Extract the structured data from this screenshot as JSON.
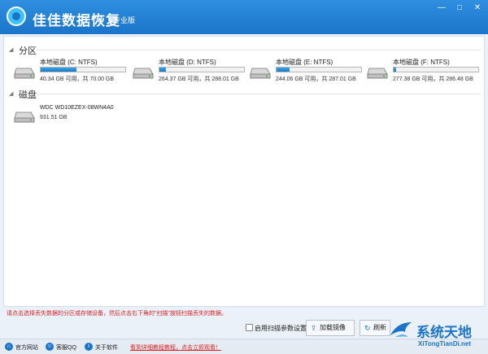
{
  "window": {
    "title": "佳佳数据恢复",
    "edition": "专业版",
    "minimize": "—",
    "maximize": "□",
    "close": "✕"
  },
  "sections": {
    "partitions": "分区",
    "disks": "磁盘"
  },
  "partitions": [
    {
      "name": "本地磁盘 (C: NTFS)",
      "info": "40.34 GB 可用，共 70.00 GB",
      "used_fraction": 0.42
    },
    {
      "name": "本地磁盘 (D: NTFS)",
      "info": "264.37 GB 可用，共 288.01 GB",
      "used_fraction": 0.08
    },
    {
      "name": "本地磁盘 (E: NTFS)",
      "info": "244.06 GB 可用，共 287.01 GB",
      "used_fraction": 0.15
    },
    {
      "name": "本地磁盘 (F: NTFS)",
      "info": "277.38 GB 可用，共 286.48 GB",
      "used_fraction": 0.03
    }
  ],
  "disks": [
    {
      "name": "WDC WD10EZEX-08WN4A0",
      "size": "931.51 GB"
    }
  ],
  "hint": "请点击选择丢失数据的分区或存储设备，然后点击右下角的\"扫描\"按钮扫描丢失的数据。",
  "controls": {
    "scan_settings_label": "启用扫描参数设置",
    "load_image_label": "加载镜像",
    "refresh_label": "刷新"
  },
  "footer": {
    "website": "官方网站",
    "qq": "客服QQ",
    "about": "关于软件",
    "tutorial_link": "看到详细教程教程，点击立即观看！"
  },
  "watermark": {
    "cn": "系统天地",
    "en": "XiTongTianDi.net"
  },
  "colors": {
    "titlebar": "#1b74c9",
    "usage_bar": "#2a8fd8",
    "hint_text": "#dd2222"
  },
  "icons": {
    "load_image": "upload-icon",
    "refresh": "refresh-icon"
  }
}
